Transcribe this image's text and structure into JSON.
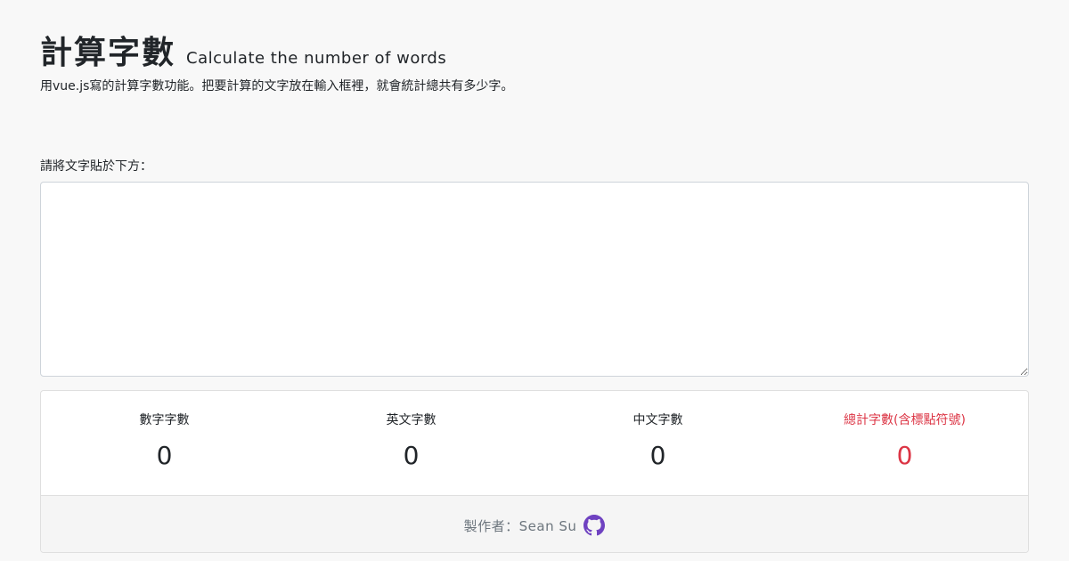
{
  "header": {
    "title": "計算字數",
    "subtitle": "Calculate the number of words",
    "description": "用vue.js寫的計算字數功能。把要計算的文字放在輸入框裡，就會統計總共有多少字。"
  },
  "input": {
    "label": "請將文字貼於下方：",
    "value": "",
    "placeholder": ""
  },
  "stats": [
    {
      "label": "數字字數",
      "value": "0"
    },
    {
      "label": "英文字數",
      "value": "0"
    },
    {
      "label": "中文字數",
      "value": "0"
    },
    {
      "label": "總計字數(含標點符號)",
      "value": "0"
    }
  ],
  "footer": {
    "author_label": "製作者：Sean Su",
    "icon": "github-icon"
  },
  "colors": {
    "total_accent": "#dc3545",
    "github_icon": "#6f42c1"
  }
}
